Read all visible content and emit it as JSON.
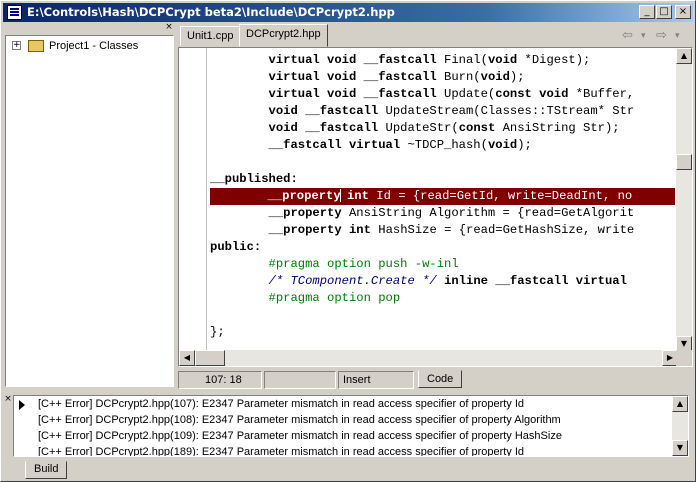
{
  "window": {
    "title": "E:\\Controls\\Hash\\DCPCrypt beta2\\Include\\DCPcrypt2.hpp",
    "minimize": "_",
    "maximize": "□",
    "close": "×"
  },
  "project_tree": {
    "close": "×",
    "expander": "+",
    "root_label": "Project1 - Classes"
  },
  "editor": {
    "tabs": [
      {
        "label": "Unit1.cpp",
        "active": false
      },
      {
        "label": "DCPcrypt2.hpp",
        "active": true
      }
    ],
    "nav_back": "⇦",
    "nav_forward": "⇨",
    "nav_dropdown": "▾"
  },
  "code_lines": [
    [
      {
        "t": "        "
      },
      {
        "t": "virtual void __fastcall",
        "k": "kw"
      },
      {
        "t": " Final("
      },
      {
        "t": "void",
        "k": "kw"
      },
      {
        "t": " *Digest);"
      }
    ],
    [
      {
        "t": "        "
      },
      {
        "t": "virtual void __fastcall",
        "k": "kw"
      },
      {
        "t": " Burn("
      },
      {
        "t": "void",
        "k": "kw"
      },
      {
        "t": ");"
      }
    ],
    [
      {
        "t": "        "
      },
      {
        "t": "virtual void __fastcall",
        "k": "kw"
      },
      {
        "t": " Update("
      },
      {
        "t": "const void",
        "k": "kw"
      },
      {
        "t": " *Buffer,"
      }
    ],
    [
      {
        "t": "        "
      },
      {
        "t": "void __fastcall",
        "k": "kw"
      },
      {
        "t": " UpdateStream(Classes::TStream* Str"
      }
    ],
    [
      {
        "t": "        "
      },
      {
        "t": "void __fastcall",
        "k": "kw"
      },
      {
        "t": " UpdateStr("
      },
      {
        "t": "const",
        "k": "kw"
      },
      {
        "t": " AnsiString Str);"
      }
    ],
    [
      {
        "t": "        "
      },
      {
        "t": "__fastcall virtual",
        "k": "kw"
      },
      {
        "t": " ~TDCP_hash("
      },
      {
        "t": "void",
        "k": "kw"
      },
      {
        "t": ");"
      }
    ],
    [
      {
        "t": ""
      }
    ],
    [
      {
        "t": "__published:",
        "k": "kw"
      }
    ],
    [
      {
        "t": "        "
      },
      {
        "t": "__property",
        "k": "kw"
      },
      {
        "t": "|",
        "k": "caret"
      },
      {
        "t": " "
      },
      {
        "t": "int",
        "k": "kw"
      },
      {
        "t": " Id = {read=GetId, write=DeadInt, no"
      }
    ],
    [
      {
        "t": "        "
      },
      {
        "t": "__property",
        "k": "kw"
      },
      {
        "t": " AnsiString Algorithm = {read=GetAlgorit"
      }
    ],
    [
      {
        "t": "        "
      },
      {
        "t": "__property",
        "k": "kw"
      },
      {
        "t": " "
      },
      {
        "t": "int",
        "k": "kw"
      },
      {
        "t": " HashSize = {read=GetHashSize, write"
      }
    ],
    [
      {
        "t": "public:",
        "k": "kw"
      }
    ],
    [
      {
        "t": "        "
      },
      {
        "t": "#pragma option push -w-inl",
        "k": "dir"
      }
    ],
    [
      {
        "t": "        "
      },
      {
        "t": "/* TComponent.Create */",
        "k": "cm"
      },
      {
        "t": " "
      },
      {
        "t": "inline __fastcall virtual",
        "k": "kw"
      }
    ],
    [
      {
        "t": "        "
      },
      {
        "t": "#pragma option pop",
        "k": "dir"
      }
    ],
    [
      {
        "t": ""
      }
    ],
    [
      {
        "t": "};"
      }
    ]
  ],
  "highlight_line": 8,
  "status": {
    "position": "107:  18",
    "modified": "",
    "mode": "Insert",
    "view_tab": "Code"
  },
  "messages": {
    "close": "×",
    "rows": [
      "[C++ Error] DCPcrypt2.hpp(107): E2347 Parameter mismatch in read access specifier of property Id",
      "[C++ Error] DCPcrypt2.hpp(108): E2347 Parameter mismatch in read access specifier of property Algorithm",
      "[C++ Error] DCPcrypt2.hpp(109): E2347 Parameter mismatch in read access specifier of property HashSize",
      "[C++ Error] DCPcrypt2.hpp(189): E2347 Parameter mismatch in read access specifier of property Id"
    ],
    "tab": "Build"
  }
}
